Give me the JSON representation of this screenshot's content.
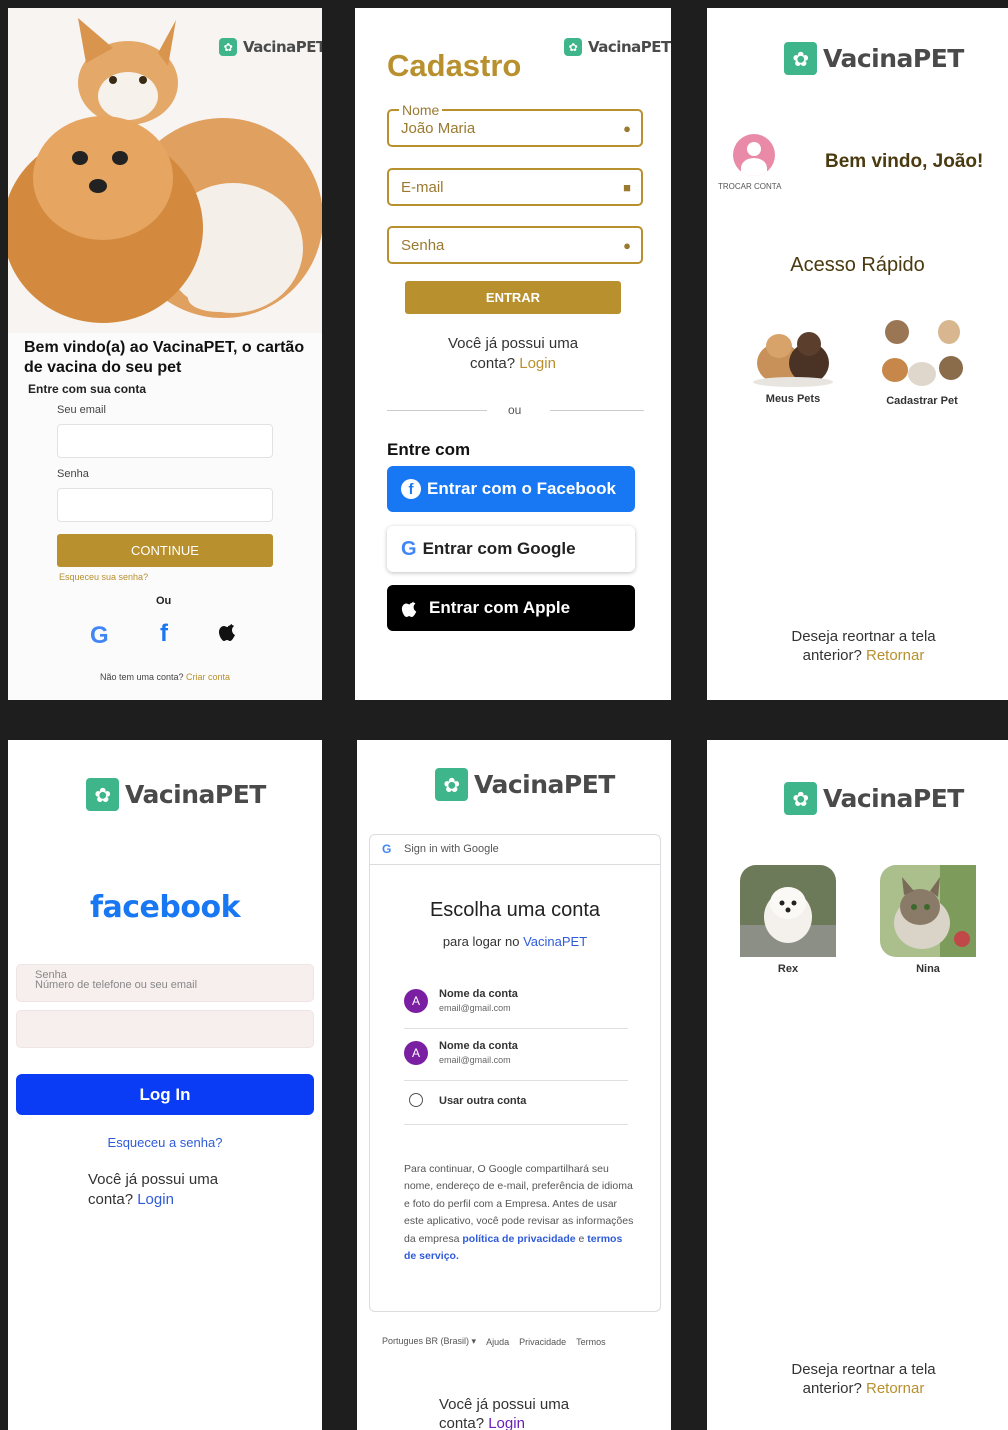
{
  "logo": {
    "text": "VacinaPET"
  },
  "screen1": {
    "welcome": "Bem vindo(a) ao VacinaPET, o cartão de vacina do seu pet",
    "subtitle": "Entre com sua conta",
    "email_label": "Seu email",
    "password_label": "Senha",
    "continue_label": "CONTINUE",
    "forgot_label": "Esqueceu sua senha?",
    "or_label": "Ou",
    "signup_prefix": "Não tem uma conta?",
    "signup_link": "Criar conta"
  },
  "screen2": {
    "title": "Cadastro",
    "name_legend": "Nome",
    "name_value": "João Maria",
    "email_placeholder": "E-mail",
    "password_placeholder": "Senha",
    "enter_label": "ENTRAR",
    "have_account_1": "Você já possui uma",
    "have_account_2": "conta?",
    "login_link": "Login",
    "or_label": "ou",
    "enter_with": "Entre com",
    "facebook_btn": "Entrar com o Facebook",
    "google_btn": "Entrar com Google",
    "apple_btn": "Entrar com Apple"
  },
  "screen3": {
    "switch_account": "TROCAR CONTA",
    "welcome": "Bem vindo, João!",
    "quick_access": "Acesso Rápido",
    "tile1": "Meus Pets",
    "tile2": "Cadastrar Pet",
    "return_1": "Deseja reortnar a tela",
    "return_2": "anterior?",
    "return_link": "Retornar"
  },
  "screen4": {
    "facebook_logo": "facebook",
    "field_label": "Senha",
    "field_placeholder": "Número de telefone ou seu email",
    "login_btn": "Log In",
    "forgot": "Esqueceu a senha?",
    "have_account_1": "Você já possui uma",
    "have_account_2": "conta?",
    "login_link": "Login"
  },
  "screen5": {
    "header": "Sign in with Google",
    "title": "Escolha uma conta",
    "subtitle_prefix": "para logar no",
    "subtitle_link": "VacinaPET",
    "accounts": [
      {
        "initial": "A",
        "name": "Nome da conta",
        "email": "email@gmail.com"
      },
      {
        "initial": "A",
        "name": "Nome da conta",
        "email": "email@gmail.com"
      }
    ],
    "other_account": "Usar outra conta",
    "disclaimer": "Para continuar, O Google compartilhará seu nome, endereço de e-mail, preferência de idioma e foto do perfil com a Empresa. Antes de usar este aplicativo, você pode revisar as informações da empresa",
    "privacy_link": "política de privacidade",
    "and": "e",
    "terms_link": "termos de serviço.",
    "language": "Portugues BR (Brasil)",
    "help": "Ajuda",
    "privacy": "Privacidade",
    "terms": "Termos",
    "have_account_1": "Você já possui uma",
    "have_account_2": "conta?",
    "login_link": "Login"
  },
  "screen6": {
    "pets": [
      {
        "name": "Rex"
      },
      {
        "name": "Nina"
      }
    ],
    "return_1": "Deseja reortnar a tela",
    "return_2": "anterior?",
    "return_link": "Retornar"
  },
  "colors": {
    "gold": "#b8902e",
    "green": "#3fb58c",
    "facebook": "#1877f2",
    "fb_login": "#0a3bf5",
    "pink": "#e98aa8"
  },
  "icons": [
    "paw-icon",
    "user-icon",
    "mail-icon",
    "lock-icon",
    "google-icon",
    "facebook-icon",
    "apple-icon",
    "chevron-down-icon"
  ]
}
